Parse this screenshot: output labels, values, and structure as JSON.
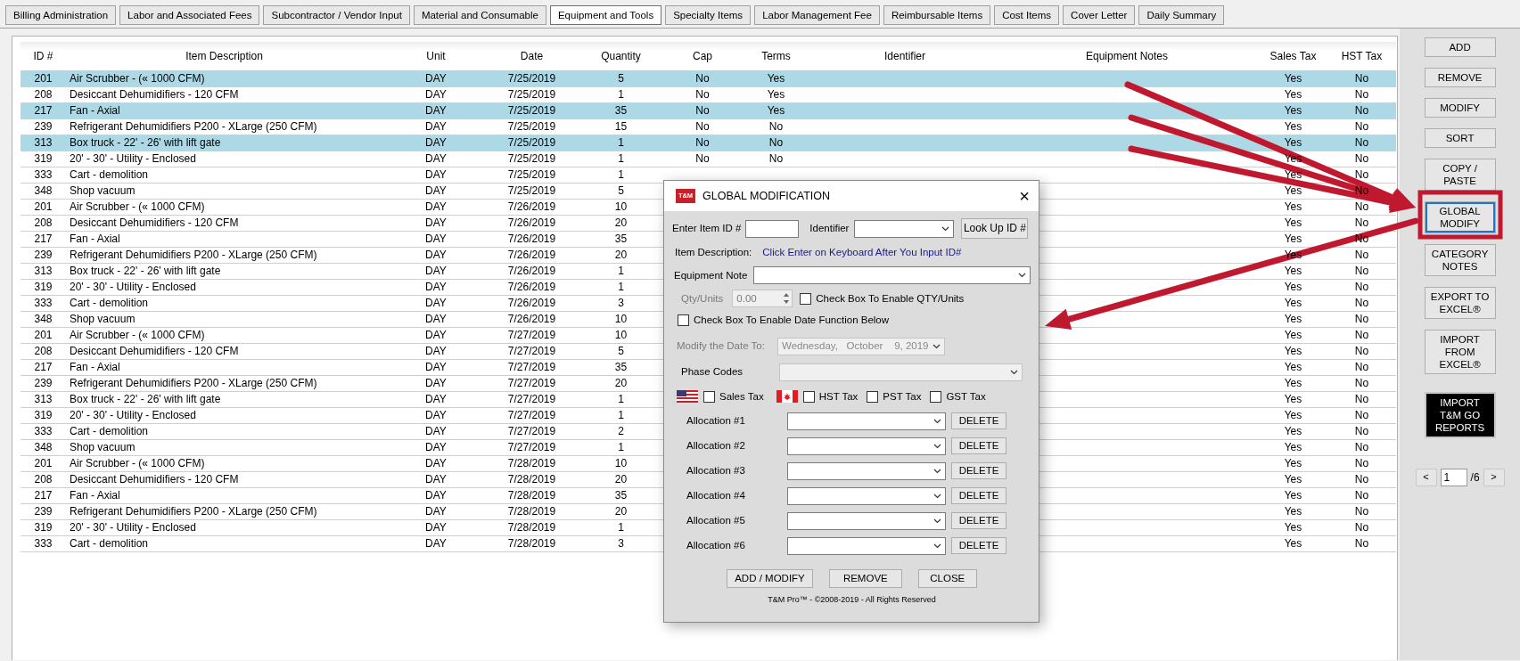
{
  "tabs": [
    {
      "label": "Billing Administration",
      "selected": false
    },
    {
      "label": "Labor and Associated Fees",
      "selected": false
    },
    {
      "label": "Subcontractor / Vendor Input",
      "selected": false
    },
    {
      "label": "Material and Consumable",
      "selected": false
    },
    {
      "label": "Equipment and Tools",
      "selected": true
    },
    {
      "label": "Specialty Items",
      "selected": false
    },
    {
      "label": "Labor Management Fee",
      "selected": false
    },
    {
      "label": "Reimbursable Items",
      "selected": false
    },
    {
      "label": "Cost Items",
      "selected": false
    },
    {
      "label": "Cover Letter",
      "selected": false
    },
    {
      "label": "Daily Summary",
      "selected": false
    }
  ],
  "table": {
    "columns": [
      "ID #",
      "Item Description",
      "Unit",
      "Date",
      "Quantity",
      "Cap",
      "Terms",
      "Identifier",
      "Equipment Notes",
      "Sales Tax",
      "HST Tax"
    ],
    "rows": [
      {
        "id": "201",
        "description": "Air Scrubber - (« 1000 CFM)",
        "unit": "DAY",
        "date": "7/25/2019",
        "quantity": "5",
        "cap": "No",
        "terms": "Yes",
        "sales_tax": "Yes",
        "hst_tax": "No",
        "selected": true
      },
      {
        "id": "208",
        "description": "Desiccant Dehumidifiers - 120 CFM",
        "unit": "DAY",
        "date": "7/25/2019",
        "quantity": "1",
        "cap": "No",
        "terms": "Yes",
        "sales_tax": "Yes",
        "hst_tax": "No",
        "selected": false
      },
      {
        "id": "217",
        "description": "Fan - Axial",
        "unit": "DAY",
        "date": "7/25/2019",
        "quantity": "35",
        "cap": "No",
        "terms": "Yes",
        "sales_tax": "Yes",
        "hst_tax": "No",
        "selected": true
      },
      {
        "id": "239",
        "description": "Refrigerant Dehumidifiers P200 - XLarge (250 CFM)",
        "unit": "DAY",
        "date": "7/25/2019",
        "quantity": "15",
        "cap": "No",
        "terms": "No",
        "sales_tax": "Yes",
        "hst_tax": "No",
        "selected": false
      },
      {
        "id": "313",
        "description": "Box truck - 22' - 26' with lift gate",
        "unit": "DAY",
        "date": "7/25/2019",
        "quantity": "1",
        "cap": "No",
        "terms": "No",
        "sales_tax": "Yes",
        "hst_tax": "No",
        "selected": true
      },
      {
        "id": "319",
        "description": "20' - 30' - Utility - Enclosed",
        "unit": "DAY",
        "date": "7/25/2019",
        "quantity": "1",
        "cap": "No",
        "terms": "No",
        "sales_tax": "Yes",
        "hst_tax": "No",
        "selected": false
      },
      {
        "id": "333",
        "description": "Cart - demolition",
        "unit": "DAY",
        "date": "7/25/2019",
        "quantity": "1",
        "sales_tax": "Yes",
        "hst_tax": "No",
        "selected": false
      },
      {
        "id": "348",
        "description": "Shop vacuum",
        "unit": "DAY",
        "date": "7/25/2019",
        "quantity": "5",
        "sales_tax": "Yes",
        "hst_tax": "No",
        "selected": false
      },
      {
        "id": "201",
        "description": "Air Scrubber - (« 1000 CFM)",
        "unit": "DAY",
        "date": "7/26/2019",
        "quantity": "10",
        "sales_tax": "Yes",
        "hst_tax": "No",
        "selected": false
      },
      {
        "id": "208",
        "description": "Desiccant Dehumidifiers - 120 CFM",
        "unit": "DAY",
        "date": "7/26/2019",
        "quantity": "20",
        "sales_tax": "Yes",
        "hst_tax": "No",
        "selected": false
      },
      {
        "id": "217",
        "description": "Fan - Axial",
        "unit": "DAY",
        "date": "7/26/2019",
        "quantity": "35",
        "sales_tax": "Yes",
        "hst_tax": "No",
        "selected": false
      },
      {
        "id": "239",
        "description": "Refrigerant Dehumidifiers P200 - XLarge (250 CFM)",
        "unit": "DAY",
        "date": "7/26/2019",
        "quantity": "20",
        "sales_tax": "Yes",
        "hst_tax": "No",
        "selected": false
      },
      {
        "id": "313",
        "description": "Box truck - 22' - 26' with lift gate",
        "unit": "DAY",
        "date": "7/26/2019",
        "quantity": "1",
        "sales_tax": "Yes",
        "hst_tax": "No",
        "selected": false
      },
      {
        "id": "319",
        "description": "20' - 30' - Utility - Enclosed",
        "unit": "DAY",
        "date": "7/26/2019",
        "quantity": "1",
        "sales_tax": "Yes",
        "hst_tax": "No",
        "selected": false
      },
      {
        "id": "333",
        "description": "Cart - demolition",
        "unit": "DAY",
        "date": "7/26/2019",
        "quantity": "3",
        "sales_tax": "Yes",
        "hst_tax": "No",
        "selected": false
      },
      {
        "id": "348",
        "description": "Shop vacuum",
        "unit": "DAY",
        "date": "7/26/2019",
        "quantity": "10",
        "sales_tax": "Yes",
        "hst_tax": "No",
        "selected": false
      },
      {
        "id": "201",
        "description": "Air Scrubber - (« 1000 CFM)",
        "unit": "DAY",
        "date": "7/27/2019",
        "quantity": "10",
        "sales_tax": "Yes",
        "hst_tax": "No",
        "selected": false
      },
      {
        "id": "208",
        "description": "Desiccant Dehumidifiers - 120 CFM",
        "unit": "DAY",
        "date": "7/27/2019",
        "quantity": "5",
        "sales_tax": "Yes",
        "hst_tax": "No",
        "selected": false
      },
      {
        "id": "217",
        "description": "Fan - Axial",
        "unit": "DAY",
        "date": "7/27/2019",
        "quantity": "35",
        "sales_tax": "Yes",
        "hst_tax": "No",
        "selected": false
      },
      {
        "id": "239",
        "description": "Refrigerant Dehumidifiers P200 - XLarge (250 CFM)",
        "unit": "DAY",
        "date": "7/27/2019",
        "quantity": "20",
        "sales_tax": "Yes",
        "hst_tax": "No",
        "selected": false
      },
      {
        "id": "313",
        "description": "Box truck - 22' - 26' with lift gate",
        "unit": "DAY",
        "date": "7/27/2019",
        "quantity": "1",
        "sales_tax": "Yes",
        "hst_tax": "No",
        "selected": false
      },
      {
        "id": "319",
        "description": "20' - 30' - Utility - Enclosed",
        "unit": "DAY",
        "date": "7/27/2019",
        "quantity": "1",
        "sales_tax": "Yes",
        "hst_tax": "No",
        "selected": false
      },
      {
        "id": "333",
        "description": "Cart - demolition",
        "unit": "DAY",
        "date": "7/27/2019",
        "quantity": "2",
        "sales_tax": "Yes",
        "hst_tax": "No",
        "selected": false
      },
      {
        "id": "348",
        "description": "Shop vacuum",
        "unit": "DAY",
        "date": "7/27/2019",
        "quantity": "1",
        "sales_tax": "Yes",
        "hst_tax": "No",
        "selected": false
      },
      {
        "id": "201",
        "description": "Air Scrubber - (« 1000 CFM)",
        "unit": "DAY",
        "date": "7/28/2019",
        "quantity": "10",
        "sales_tax": "Yes",
        "hst_tax": "No",
        "selected": false
      },
      {
        "id": "208",
        "description": "Desiccant Dehumidifiers - 120 CFM",
        "unit": "DAY",
        "date": "7/28/2019",
        "quantity": "20",
        "sales_tax": "Yes",
        "hst_tax": "No",
        "selected": false
      },
      {
        "id": "217",
        "description": "Fan - Axial",
        "unit": "DAY",
        "date": "7/28/2019",
        "quantity": "35",
        "sales_tax": "Yes",
        "hst_tax": "No",
        "selected": false
      },
      {
        "id": "239",
        "description": "Refrigerant Dehumidifiers P200 - XLarge (250 CFM)",
        "unit": "DAY",
        "date": "7/28/2019",
        "quantity": "20",
        "sales_tax": "Yes",
        "hst_tax": "No",
        "selected": false
      },
      {
        "id": "319",
        "description": "20' - 30' - Utility - Enclosed",
        "unit": "DAY",
        "date": "7/28/2019",
        "quantity": "1",
        "sales_tax": "Yes",
        "hst_tax": "No",
        "selected": false
      },
      {
        "id": "333",
        "description": "Cart - demolition",
        "unit": "DAY",
        "date": "7/28/2019",
        "quantity": "3",
        "sales_tax": "Yes",
        "hst_tax": "No",
        "selected": false
      }
    ]
  },
  "side_buttons": [
    {
      "label": "ADD",
      "kind": "normal",
      "focused": false
    },
    {
      "label": "REMOVE",
      "kind": "normal",
      "focused": false
    },
    {
      "label": "MODIFY",
      "kind": "normal",
      "focused": false
    },
    {
      "label": "SORT",
      "kind": "normal",
      "focused": false
    },
    {
      "label": "COPY /\nPASTE",
      "kind": "normal",
      "focused": false
    },
    {
      "label": "GLOBAL\nMODIFY",
      "kind": "normal",
      "focused": true
    },
    {
      "label": "CATEGORY\nNOTES",
      "kind": "normal",
      "focused": false
    },
    {
      "label": "EXPORT TO\nEXCEL®",
      "kind": "normal",
      "focused": false
    },
    {
      "label": "IMPORT\nFROM\nEXCEL®",
      "kind": "normal",
      "focused": false
    },
    {
      "label": "IMPORT\nT&M GO\nREPORTS",
      "kind": "dark",
      "focused": false
    }
  ],
  "pager": {
    "prev": "<",
    "page": "1",
    "total": "/6",
    "next": ">"
  },
  "dialog": {
    "logo": "T&M",
    "title": "GLOBAL MODIFICATION",
    "close": "×",
    "item_id": {
      "label": "Enter Item ID #"
    },
    "identifier": {
      "label": "Identifier"
    },
    "lookup_button": "Look Up ID #",
    "item_description": {
      "label": "Item Description:",
      "hint": "Click Enter on Keyboard After You Input ID#"
    },
    "equipment_note": {
      "label": "Equipment Note"
    },
    "qty": {
      "label": "Qty/Units",
      "value": "0.00",
      "disabled": true
    },
    "qty_checkbox": {
      "label": "Check Box To Enable QTY/Units",
      "checked": false
    },
    "date_checkbox": {
      "label": "Check Box To Enable Date Function Below",
      "checked": false
    },
    "modify_date": {
      "label": "Modify the Date To:",
      "value": "Wednesday,   October    9, 2019",
      "disabled": true
    },
    "phase_codes": {
      "label": "Phase Codes",
      "disabled": true
    },
    "taxes": [
      {
        "label": "Sales Tax",
        "checked": false,
        "kind": "us"
      },
      {
        "label": "HST Tax",
        "checked": false,
        "kind": "canada"
      },
      {
        "label": "PST Tax",
        "checked": false,
        "kind": "plain"
      },
      {
        "label": "GST Tax",
        "checked": false,
        "kind": "plain"
      }
    ],
    "allocations": [
      {
        "label": "Allocation #1",
        "button": "DELETE"
      },
      {
        "label": "Allocation #2",
        "button": "DELETE"
      },
      {
        "label": "Allocation #3",
        "button": "DELETE"
      },
      {
        "label": "Allocation #4",
        "button": "DELETE"
      },
      {
        "label": "Allocation #5",
        "button": "DELETE"
      },
      {
        "label": "Allocation #6",
        "button": "DELETE"
      }
    ],
    "buttons": [
      "ADD / MODIFY",
      "REMOVE",
      "CLOSE"
    ],
    "footer": "T&M Pro™ - ©2008-2019 - All Rights Reserved"
  },
  "annotations": [
    {
      "kind": "arrow"
    },
    {
      "kind": "arrow"
    },
    {
      "kind": "arrow"
    },
    {
      "kind": "arrow"
    },
    {
      "kind": "frame"
    }
  ]
}
